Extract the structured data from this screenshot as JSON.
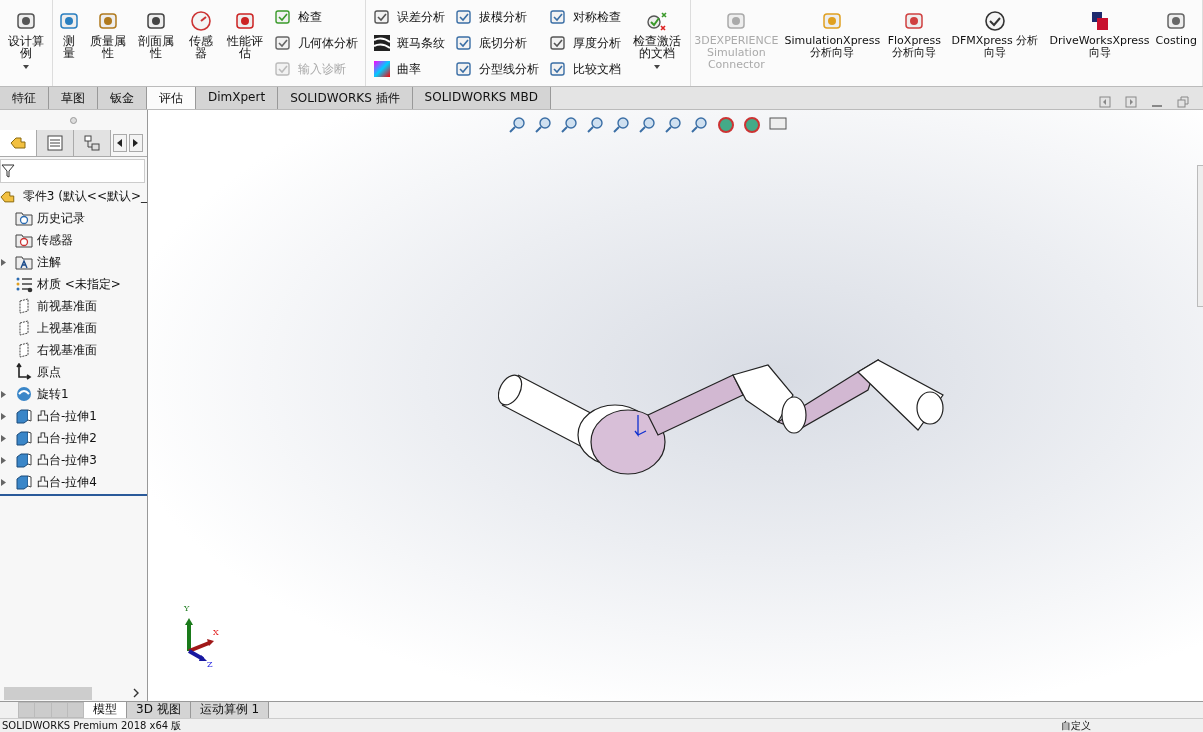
{
  "ribbon": {
    "groups": [
      {
        "large": [
          {
            "label": "设计算例",
            "caret": true,
            "disabled": false
          }
        ]
      },
      {
        "large": [
          {
            "label": "测量",
            "caret": false,
            "disabled": false
          },
          {
            "label": "质量属性",
            "caret": false,
            "disabled": false
          },
          {
            "label": "剖面属性",
            "caret": false,
            "disabled": false
          },
          {
            "label": "传感器",
            "caret": false,
            "disabled": false
          },
          {
            "label": "性能评估",
            "caret": false,
            "disabled": false
          }
        ],
        "columns": [
          [
            {
              "label": "检查",
              "disabled": false
            },
            {
              "label": "几何体分析",
              "disabled": false
            },
            {
              "label": "输入诊断",
              "disabled": true
            }
          ]
        ]
      },
      {
        "columns": [
          [
            {
              "label": "误差分析",
              "disabled": false
            },
            {
              "label": "斑马条纹",
              "disabled": false
            },
            {
              "label": "曲率",
              "disabled": false
            }
          ],
          [
            {
              "label": "拔模分析",
              "disabled": false
            },
            {
              "label": "底切分析",
              "disabled": false
            },
            {
              "label": "分型线分析",
              "disabled": false
            }
          ],
          [
            {
              "label": "对称检查",
              "disabled": false
            },
            {
              "label": "厚度分析",
              "disabled": false
            },
            {
              "label": "比较文档",
              "disabled": false
            }
          ]
        ],
        "trailing": [
          {
            "label": "检查激活的文档",
            "caret": true,
            "disabled": false
          }
        ]
      },
      {
        "large": [
          {
            "label": "3DEXPERIENCE Simulation Connector",
            "caret": false,
            "disabled": true
          },
          {
            "label": "SimulationXpress 分析向导",
            "caret": false,
            "disabled": false
          },
          {
            "label": "FloXpress 分析向导",
            "caret": false,
            "disabled": false
          },
          {
            "label": "DFMXpress 分析向导",
            "caret": false,
            "disabled": false
          },
          {
            "label": "DriveWorksXpress 向导",
            "caret": false,
            "disabled": false
          },
          {
            "label": "Costing",
            "caret": false,
            "disabled": false
          }
        ]
      }
    ]
  },
  "tabs": [
    {
      "label": "特征",
      "selected": false
    },
    {
      "label": "草图",
      "selected": false
    },
    {
      "label": "钣金",
      "selected": false
    },
    {
      "label": "评估",
      "selected": true
    },
    {
      "label": "DimXpert",
      "selected": false
    },
    {
      "label": "SOLIDWORKS 插件",
      "selected": false
    },
    {
      "label": "SOLIDWORKS MBD",
      "selected": false
    }
  ],
  "panel_tabs": [
    {
      "selected": true
    },
    {
      "selected": false
    },
    {
      "selected": false
    }
  ],
  "tree": {
    "label": "零件3  (默认<<默认>_",
    "children": [
      {
        "label": "历史记录",
        "expandable": false
      },
      {
        "label": "传感器",
        "expandable": false
      },
      {
        "label": "注解",
        "expandable": true
      },
      {
        "label": "材质 <未指定>",
        "expandable": false
      },
      {
        "label": "前视基准面",
        "expandable": false
      },
      {
        "label": "上视基准面",
        "expandable": false
      },
      {
        "label": "右视基准面",
        "expandable": false
      },
      {
        "label": "原点",
        "expandable": false
      },
      {
        "label": "旋转1",
        "expandable": true
      },
      {
        "label": "凸台-拉伸1",
        "expandable": true
      },
      {
        "label": "凸台-拉伸2",
        "expandable": true
      },
      {
        "label": "凸台-拉伸3",
        "expandable": true
      },
      {
        "label": "凸台-拉伸4",
        "expandable": true
      }
    ]
  },
  "triad": {
    "x": "X",
    "y": "Y",
    "z": "Z"
  },
  "bottom_tabs": [
    {
      "label": "模型",
      "selected": true
    },
    {
      "label": "3D 视图",
      "selected": false
    },
    {
      "label": "运动算例 1",
      "selected": false
    }
  ],
  "status_bar": {
    "left": "SOLIDWORKS Premium 2018 x64 版",
    "right": "自定义"
  }
}
